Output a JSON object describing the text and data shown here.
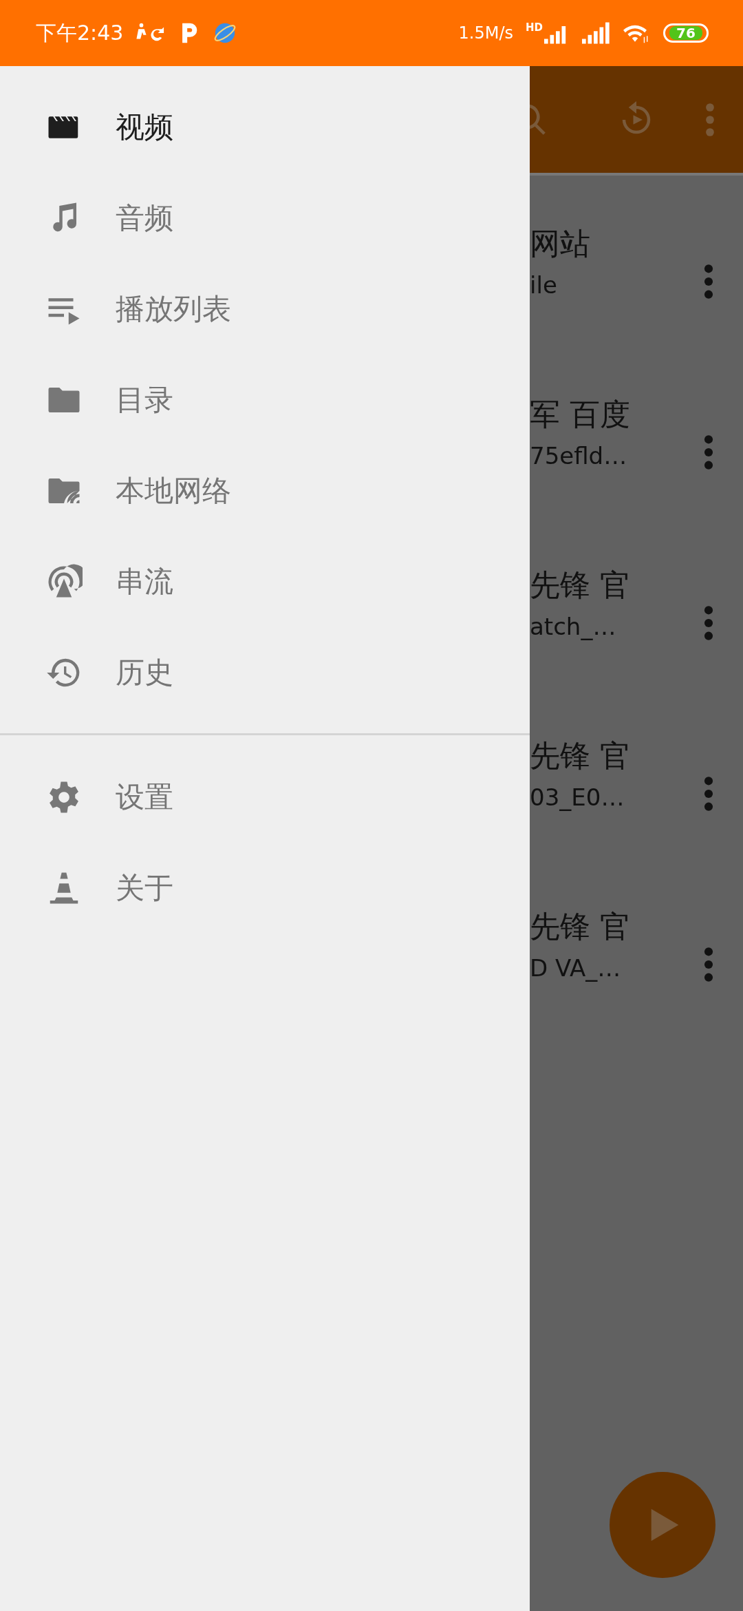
{
  "status_bar": {
    "time": "下午2:43",
    "network_speed": "1.5M/s",
    "signal_badge": "HD",
    "battery": "76"
  },
  "drawer": {
    "primary_items": [
      {
        "label": "视频",
        "selected": true
      },
      {
        "label": "音频",
        "selected": false
      },
      {
        "label": "播放列表",
        "selected": false
      },
      {
        "label": "目录",
        "selected": false
      },
      {
        "label": "本地网络",
        "selected": false
      },
      {
        "label": "串流",
        "selected": false
      },
      {
        "label": "历史",
        "selected": false
      }
    ],
    "secondary_items": [
      {
        "label": "设置",
        "selected": false
      },
      {
        "label": "关于",
        "selected": false
      }
    ]
  },
  "background_list": [
    {
      "title": "网站",
      "subtitle": "ile"
    },
    {
      "title": "军 百度",
      "subtitle": "75efld…"
    },
    {
      "title": "先锋 官",
      "subtitle": "atch_…"
    },
    {
      "title": "先锋 官",
      "subtitle": "03_E0…"
    },
    {
      "title": "先锋 官",
      "subtitle": "D VA_…"
    }
  ]
}
